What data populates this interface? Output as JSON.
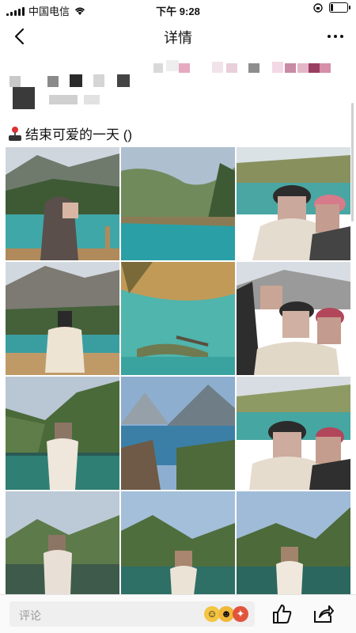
{
  "status_bar": {
    "carrier": "中国电信",
    "time": "下午 9:28"
  },
  "nav": {
    "title": "详情"
  },
  "post": {
    "emoji_icon": "joystick-icon",
    "text": "结束可爱的一天 ()"
  },
  "photos": [
    {
      "scene": "lake-person"
    },
    {
      "scene": "lake-mountains"
    },
    {
      "scene": "selfie-two"
    },
    {
      "scene": "person-coat"
    },
    {
      "scene": "turquoise-lake"
    },
    {
      "scene": "selfie-three"
    },
    {
      "scene": "person-railing"
    },
    {
      "scene": "valley-lake"
    },
    {
      "scene": "selfie-two-b"
    },
    {
      "scene": "person-walk"
    },
    {
      "scene": "person-bridge"
    },
    {
      "scene": "person-forest"
    }
  ],
  "comment": {
    "placeholder": "评论"
  },
  "colors": {
    "lake": "#3fa7a8",
    "sky": "#b7c7d8",
    "forest": "#4d6b3a"
  }
}
